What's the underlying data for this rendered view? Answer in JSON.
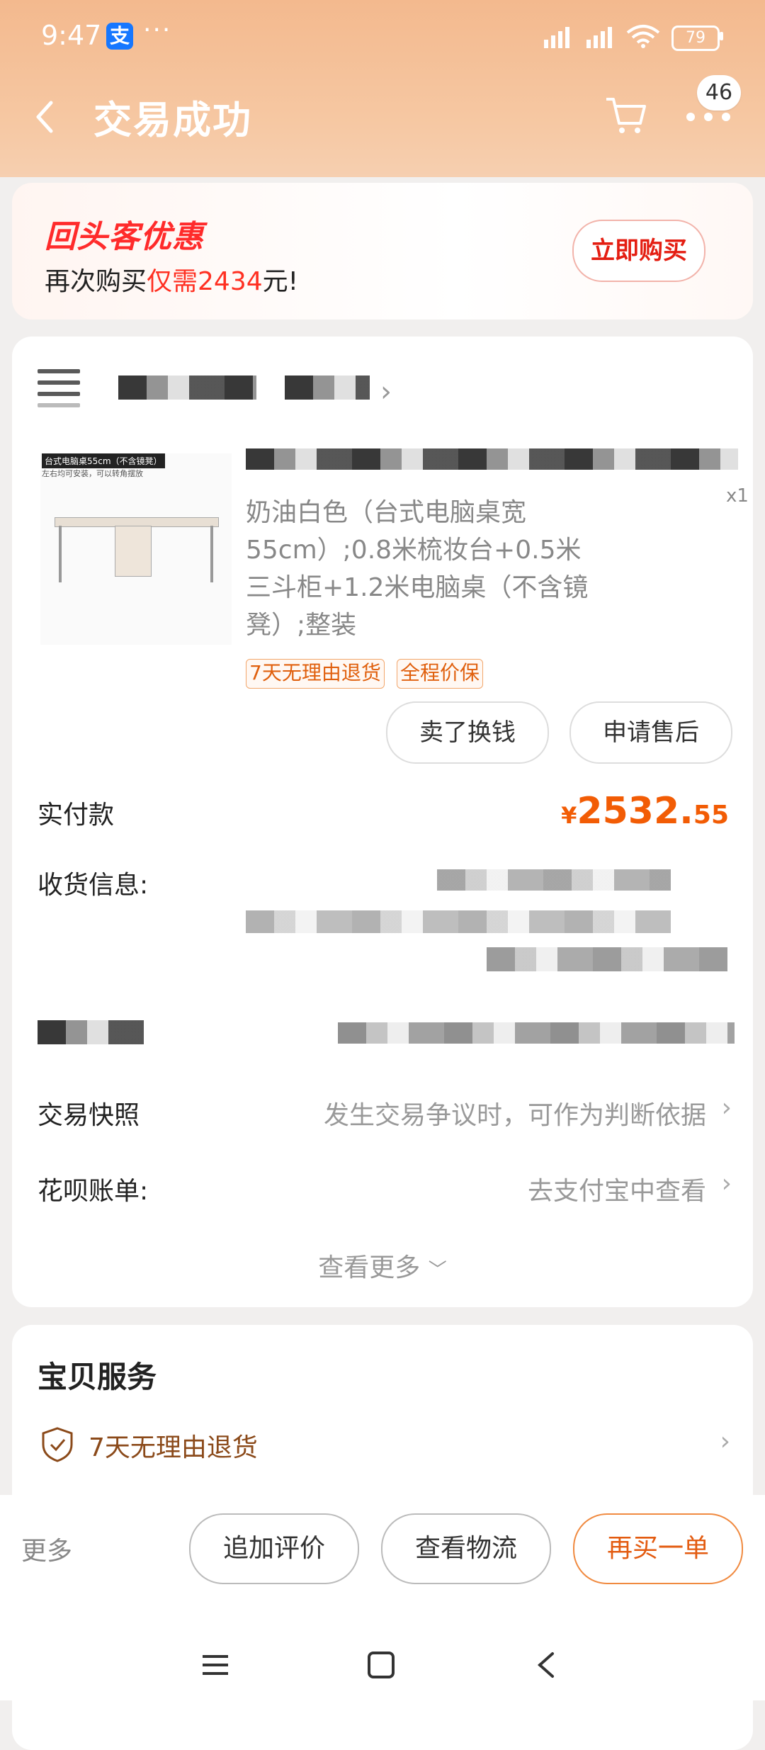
{
  "status_bar": {
    "time": "9:47",
    "alipay": "支",
    "dots": "···",
    "battery": "79"
  },
  "header": {
    "title": "交易成功",
    "more_badge": "46"
  },
  "promo": {
    "logo": "回头客优惠",
    "text_pre": "再次购买",
    "text_hl": "仅需2434",
    "text_post": "元!",
    "button": "立即购买"
  },
  "order": {
    "product": {
      "image_tag": "台式电脑桌55cm（不含镜凳）",
      "image_sub": "左右均可安装，可以转角摆放",
      "spec": "奶油白色（台式电脑桌宽55cm）;0.8米梳妆台+0.5米三斗柜+1.2米电脑桌（不含镜凳）;整装",
      "qty": "x1",
      "badges": [
        "7天无理由退货",
        "全程价保"
      ],
      "buttons": {
        "sell": "卖了换钱",
        "after_sale": "申请售后"
      }
    },
    "paid": {
      "label": "实付款",
      "symbol": "¥",
      "integer": "2532.",
      "decimal": "55"
    },
    "shipping": {
      "label": "收货信息:"
    },
    "snapshot": {
      "label": "交易快照",
      "value": "发生交易争议时，可作为判断依据"
    },
    "huabei": {
      "label": "花呗账单:",
      "value": "去支付宝中查看"
    },
    "more": "查看更多"
  },
  "service": {
    "title": "宝贝服务",
    "item": "7天无理由退货"
  },
  "bottom": {
    "more": "更多",
    "review": "追加评价",
    "logistics": "查看物流",
    "rebuy": "再买一单"
  }
}
